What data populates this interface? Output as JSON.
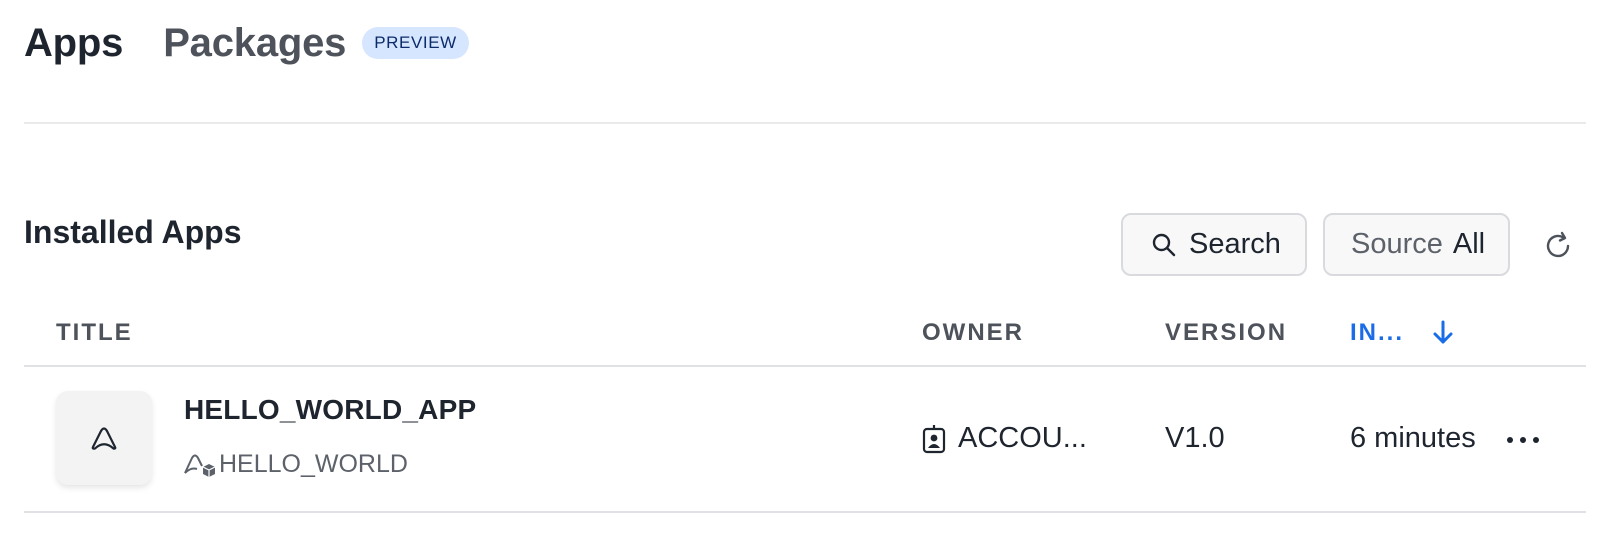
{
  "tabs": [
    {
      "label": "Apps",
      "active": true
    },
    {
      "label": "Packages",
      "active": false,
      "badge": "PREVIEW"
    }
  ],
  "section": {
    "title": "Installed Apps"
  },
  "toolbar": {
    "search_label": "Search",
    "search_icon": "search-icon",
    "source_label": "Source",
    "source_value": "All",
    "refresh_icon": "refresh-icon"
  },
  "table": {
    "columns": [
      "TITLE",
      "OWNER",
      "VERSION",
      "IN..."
    ],
    "sort_icon": "arrow-down-icon",
    "rows": [
      {
        "title": "HELLO_WORLD_APP",
        "package": "HELLO_WORLD",
        "owner": "ACCOU...",
        "version": "V1.0",
        "installed": "6 minutes"
      }
    ]
  },
  "colors": {
    "accent": "#1a6ce7",
    "badge_bg": "#d6e6ff",
    "text": "#1e252f",
    "muted": "#4d525b"
  }
}
